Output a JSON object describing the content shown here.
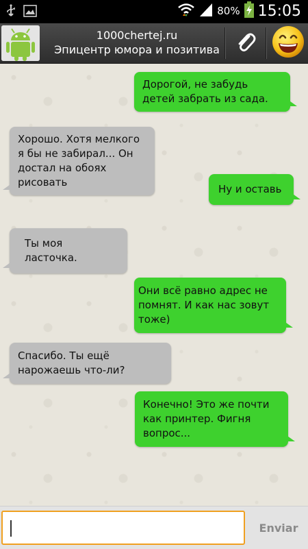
{
  "status_bar": {
    "battery_percent": "80%",
    "time": "15:05",
    "icons": [
      "usb-icon",
      "image-icon",
      "wifi-icon",
      "signal-icon",
      "battery-charging-icon"
    ]
  },
  "header": {
    "contact_name": "1000chertej.ru",
    "contact_status": "Эпицентр юмора и позитива",
    "avatar_icon": "android-robot-icon",
    "attach_icon": "paperclip-icon",
    "emoji_icon": "smiley-icon"
  },
  "messages": [
    {
      "direction": "out",
      "text": "Дорогой, не забудь детей забрать из сада."
    },
    {
      "direction": "in",
      "text": "Хорошо. Хотя мелкого я бы не забирал... Он достал на обоях рисовать"
    },
    {
      "direction": "out",
      "text": "Ну и оставь"
    },
    {
      "direction": "in",
      "text": "Ты моя ласточка."
    },
    {
      "direction": "out",
      "text": "Они всё равно адрес не помнят. И как нас зовут тоже)"
    },
    {
      "direction": "in",
      "text": "Спасибо. Ты ещё нарожаешь что-ли?"
    },
    {
      "direction": "out",
      "text": "Конечно! Это же почти как принтер. Фигня вопрос..."
    }
  ],
  "composer": {
    "value": "",
    "send_label": "Enviar"
  },
  "colors": {
    "outgoing_bubble": "#3ed12e",
    "incoming_bubble": "#bdbdbd",
    "input_focus_border": "#f0a020"
  }
}
